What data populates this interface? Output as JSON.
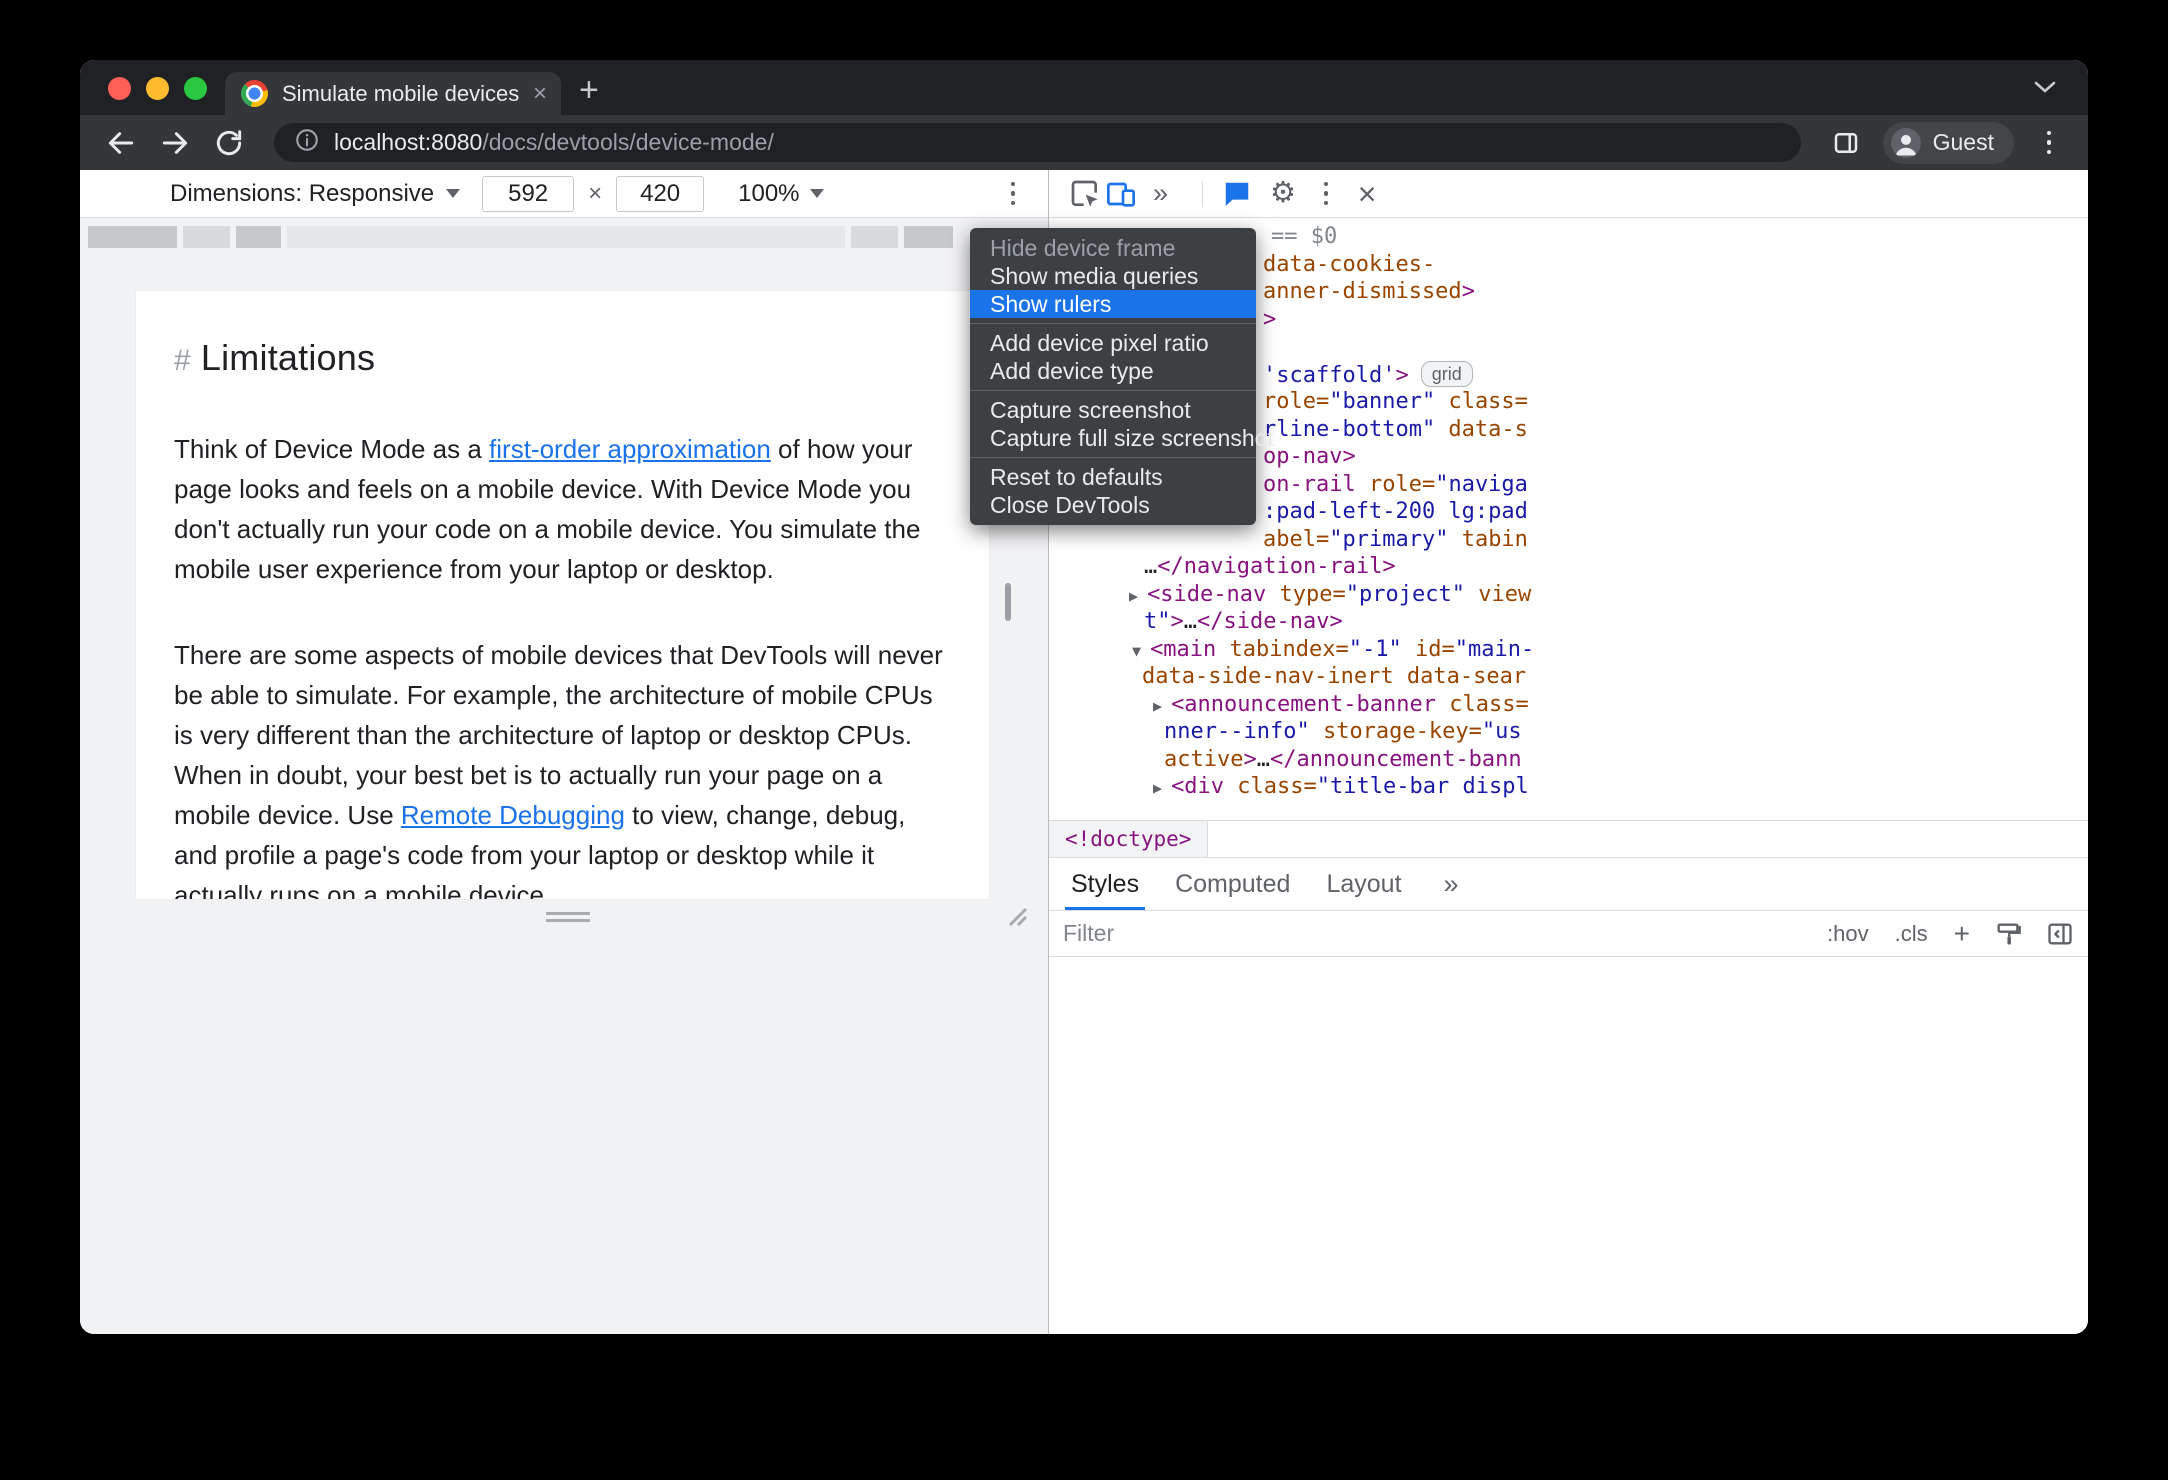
{
  "tab_strip": {
    "tab_title": "Simulate mobile devices with D",
    "close_glyph": "×",
    "new_tab_glyph": "+"
  },
  "toolbar": {
    "url_host": "localhost:8080",
    "url_path": "/docs/devtools/device-mode/",
    "guest_label": "Guest"
  },
  "device_toolbar": {
    "dimensions_label": "Dimensions: Responsive",
    "width_value": "592",
    "multiply_glyph": "×",
    "height_value": "420",
    "zoom_value": "100%"
  },
  "devtools_toolbar": {
    "overflow_glyph": "»",
    "close_glyph": "×",
    "gear_glyph": "⚙"
  },
  "context_menu": {
    "items": [
      {
        "label": "Hide device frame",
        "disabled": true
      },
      {
        "label": "Show media queries"
      },
      {
        "label": "Show rulers",
        "highlighted": true
      },
      {
        "divider": true
      },
      {
        "label": "Add device pixel ratio"
      },
      {
        "label": "Add device type"
      },
      {
        "divider": true
      },
      {
        "label": "Capture screenshot"
      },
      {
        "label": "Capture full size screenshot"
      },
      {
        "divider": true
      },
      {
        "label": "Reset to defaults"
      },
      {
        "label": "Close DevTools"
      }
    ]
  },
  "page": {
    "heading_marker": "#",
    "heading": "Limitations",
    "paragraphs": [
      [
        {
          "text": "Think of Device Mode as a "
        },
        {
          "text": "first-order approximation",
          "link": true
        },
        {
          "text": " of how your page looks and feels on a mobile device. With Device Mode you don't actually run your code on a mobile device. You simulate the mobile user experience from your laptop or desktop."
        }
      ],
      [
        {
          "text": "There are some aspects of mobile devices that DevTools will never be able to simulate. For example, the architecture of mobile CPUs is very different than the architecture of laptop or desktop CPUs. When in doubt, your best bet is to actually run your page on a mobile device. Use "
        },
        {
          "text": "Remote Debugging",
          "link": true
        },
        {
          "text": " to view, change, debug, and profile a page's code from your laptop or desktop while it actually runs on a mobile device."
        }
      ]
    ]
  },
  "elements_panel": {
    "breadcrumb": "<!doctype>",
    "tabs": [
      {
        "label": "Styles",
        "active": true
      },
      {
        "label": "Computed"
      },
      {
        "label": "Layout"
      }
    ],
    "tabs_overflow": "»",
    "styles_toolbar": {
      "filter_placeholder": "Filter",
      "hov": ":hov",
      "cls": ".cls",
      "new_rule": "+"
    },
    "code_lines": [
      {
        "pad": 222,
        "tokens": [
          {
            "c": "g",
            "t": "== $0"
          }
        ]
      },
      {
        "pad": 214,
        "tokens": [
          {
            "c": "a",
            "t": "data-cookies-"
          }
        ]
      },
      {
        "pad": 214,
        "tokens": [
          {
            "c": "a",
            "t": "anner-dismissed"
          },
          {
            "c": "t",
            "t": ">"
          }
        ]
      },
      {
        "pad": 214,
        "tokens": [
          {
            "c": "t",
            "t": ">"
          }
        ]
      },
      {
        "pad": 214,
        "tokens": []
      },
      {
        "pad": 214,
        "tokens": [
          {
            "c": "v",
            "t": "'scaffold'"
          },
          {
            "c": "t",
            "t": ">"
          }
        ],
        "badge": "grid"
      },
      {
        "pad": 214,
        "tokens": [
          {
            "c": "a",
            "t": "role="
          },
          {
            "c": "v",
            "t": "\"banner\""
          },
          {
            "c": "a",
            "t": " class="
          }
        ]
      },
      {
        "pad": 214,
        "tokens": [
          {
            "c": "v",
            "t": "rline-bottom\""
          },
          {
            "c": "a",
            "t": " data-s"
          }
        ]
      },
      {
        "pad": 214,
        "tokens": [
          {
            "c": "t",
            "t": "op-nav>"
          }
        ]
      },
      {
        "pad": 214,
        "tokens": [
          {
            "c": "t",
            "t": "on-rail"
          },
          {
            "c": "a",
            "t": " role="
          },
          {
            "c": "v",
            "t": "\"naviga"
          }
        ]
      },
      {
        "pad": 214,
        "tokens": [
          {
            "c": "v",
            "t": ":pad-left-200 lg:pad"
          }
        ]
      },
      {
        "pad": 214,
        "tokens": [
          {
            "c": "a",
            "t": "abel="
          },
          {
            "c": "v",
            "t": "\"primary\""
          },
          {
            "c": "a",
            "t": " tabin"
          }
        ]
      },
      {
        "pad": 95,
        "tokens": [
          {
            "c": "p",
            "t": "…"
          },
          {
            "c": "t",
            "t": "</navigation-rail>"
          }
        ]
      },
      {
        "pad": 80,
        "tokens": [
          {
            "c": "arr",
            "t": "▶ "
          },
          {
            "c": "t",
            "t": "<side-nav"
          },
          {
            "c": "a",
            "t": " type="
          },
          {
            "c": "v",
            "t": "\"project\""
          },
          {
            "c": "a",
            "t": " view"
          }
        ]
      },
      {
        "pad": 95,
        "tokens": [
          {
            "c": "v",
            "t": "t\""
          },
          {
            "c": "t",
            "t": ">"
          },
          {
            "c": "p",
            "t": "…"
          },
          {
            "c": "t",
            "t": "</side-nav>"
          }
        ]
      },
      {
        "pad": 83,
        "tokens": [
          {
            "c": "arr",
            "t": "▼ "
          },
          {
            "c": "t",
            "t": "<main"
          },
          {
            "c": "a",
            "t": " tabindex="
          },
          {
            "c": "v",
            "t": "\"-1\""
          },
          {
            "c": "a",
            "t": " id="
          },
          {
            "c": "v",
            "t": "\"main-"
          }
        ]
      },
      {
        "pad": 93,
        "tokens": [
          {
            "c": "a",
            "t": "data-side-nav-inert data-sear"
          }
        ]
      },
      {
        "pad": 104,
        "tokens": [
          {
            "c": "arr",
            "t": "▶ "
          },
          {
            "c": "t",
            "t": "<announcement-banner"
          },
          {
            "c": "a",
            "t": " class="
          }
        ]
      },
      {
        "pad": 115,
        "tokens": [
          {
            "c": "v",
            "t": "nner--info\""
          },
          {
            "c": "a",
            "t": " storage-key="
          },
          {
            "c": "v",
            "t": "\"us"
          }
        ]
      },
      {
        "pad": 115,
        "tokens": [
          {
            "c": "a",
            "t": "active"
          },
          {
            "c": "t",
            "t": ">"
          },
          {
            "c": "p",
            "t": "…"
          },
          {
            "c": "t",
            "t": "</announcement-bann"
          }
        ]
      },
      {
        "pad": 104,
        "tokens": [
          {
            "c": "arr",
            "t": "▶ "
          },
          {
            "c": "t",
            "t": "<div"
          },
          {
            "c": "a",
            "t": " class="
          },
          {
            "c": "v",
            "t": "\"title-bar displ"
          }
        ]
      }
    ]
  },
  "colors": {
    "accent_blue": "#1a73e8",
    "menu_bg": "#3c4043",
    "tag": "#881280",
    "attr": "#994500",
    "value": "#1a1aa6"
  }
}
